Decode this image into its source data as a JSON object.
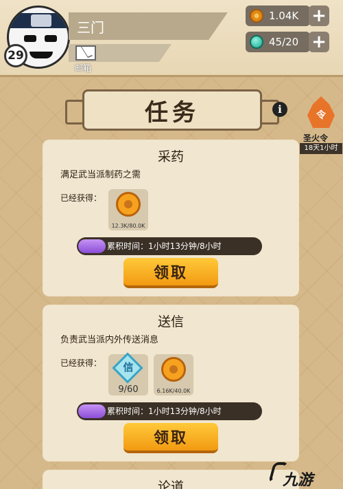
{
  "header": {
    "player_name": "三门",
    "level": "29",
    "mail_label": "邮箱",
    "coins": "1.04K",
    "gems": "45/20",
    "plus_glyph": "+"
  },
  "page": {
    "title": "任务",
    "info_glyph": "i",
    "token_glyph": "令",
    "token_name": "圣火令",
    "token_time": "18天1小时"
  },
  "tasks": [
    {
      "title": "采药",
      "desc": "满足武当派制药之需",
      "got_label": "已经获得：",
      "rewards": [
        {
          "icon": "coin-icon",
          "amount": "12.3K/80.0K",
          "progress": 0.154
        }
      ],
      "progress_text": "累积时间：1小时13分钟/8小时",
      "progress_fraction": 0.152,
      "button": "领取"
    },
    {
      "title": "送信",
      "desc": "负责武当派内外传送消息",
      "got_label": "已经获得：",
      "rewards": [
        {
          "icon": "scroll-gem-icon",
          "glyph": "信",
          "amount": "9/60"
        },
        {
          "icon": "coin-icon",
          "amount": "6.16K/40.0K"
        }
      ],
      "progress_text": "累积时间：1小时13分钟/8小时",
      "progress_fraction": 0.152,
      "button": "领取"
    },
    {
      "title": "论道"
    }
  ],
  "watermark": "九游",
  "colors": {
    "button": "#f5a81c",
    "progress_fill": "#a66ae6",
    "card": "#f1e6cf",
    "background": "#d9bd8d"
  }
}
